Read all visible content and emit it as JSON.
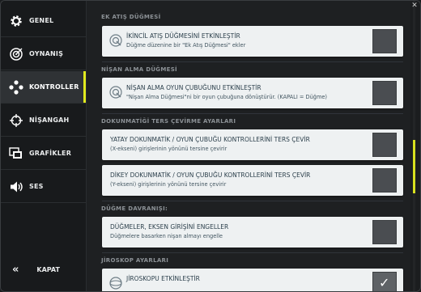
{
  "colors": {
    "accent": "#e1ea1e",
    "card_bg": "#eef1f2",
    "checkbox": "#4a4d51"
  },
  "sidebar": {
    "items": [
      {
        "label": "GENEL",
        "icon": "gear-icon"
      },
      {
        "label": "OYNANIŞ",
        "icon": "target-icon"
      },
      {
        "label": "KONTROLLER",
        "icon": "dpad-icon",
        "active": true
      },
      {
        "label": "NİŞANGAH",
        "icon": "crosshair-icon"
      },
      {
        "label": "GRAFİKLER",
        "icon": "graphics-icon"
      },
      {
        "label": "SES",
        "icon": "speaker-icon"
      }
    ],
    "close_label": "KAPAT",
    "close_icon": "double-chevron-left-icon"
  },
  "sections": {
    "s1": "EK ATIŞ DÜĞMESİ",
    "s2": "NİŞAN ALMA DÜĞMESİ",
    "s3": "DOKUNMATİĞİ TERS ÇEVİRME AYARLARI",
    "s4": "DÜĞME DAVRANIŞI:",
    "s5": "JİROSKOP AYARLARI"
  },
  "settings": {
    "secondary_fire": {
      "title": "İKİNCİL ATIŞ DÜĞMESİNİ ETKİNLEŞTİR",
      "desc": "Düğme düzenine bir \"Ek Atış Düğmesi\" ekler",
      "checked": false
    },
    "aim_joystick": {
      "title": "NİŞAN ALMA OYUN ÇUBUĞUNU ETKİNLEŞTİR",
      "desc": "\"Nişan Alma Düğmesi\"ni bir oyun çubuğuna dönüştürür. (KAPALI = Düğme)",
      "checked": false
    },
    "invert_horizontal": {
      "title": "YATAY DOKUNMATİK / OYUN ÇUBUĞU KONTROLLERİNİ TERS ÇEVİR",
      "desc": "(X-ekseni) girişlerinin yönünü tersine çevirir",
      "checked": false
    },
    "invert_vertical": {
      "title": "DİKEY DOKUNMATİK / OYUN ÇUBUĞU KONTROLLERİNİ TERS ÇEVİR",
      "desc": "(Y-ekseni) girişlerinin yönünü tersine çevirir",
      "checked": false
    },
    "block_axis": {
      "title": "DÜĞMELER, EKSEN GİRİŞİNİ ENGELLER",
      "desc": "Düğmelere basarken nişan almayı engelle",
      "checked": false
    },
    "gyroscope": {
      "title": "JİROSKOPU ETKİNLEŞTİR",
      "desc": "",
      "checked": true
    }
  }
}
